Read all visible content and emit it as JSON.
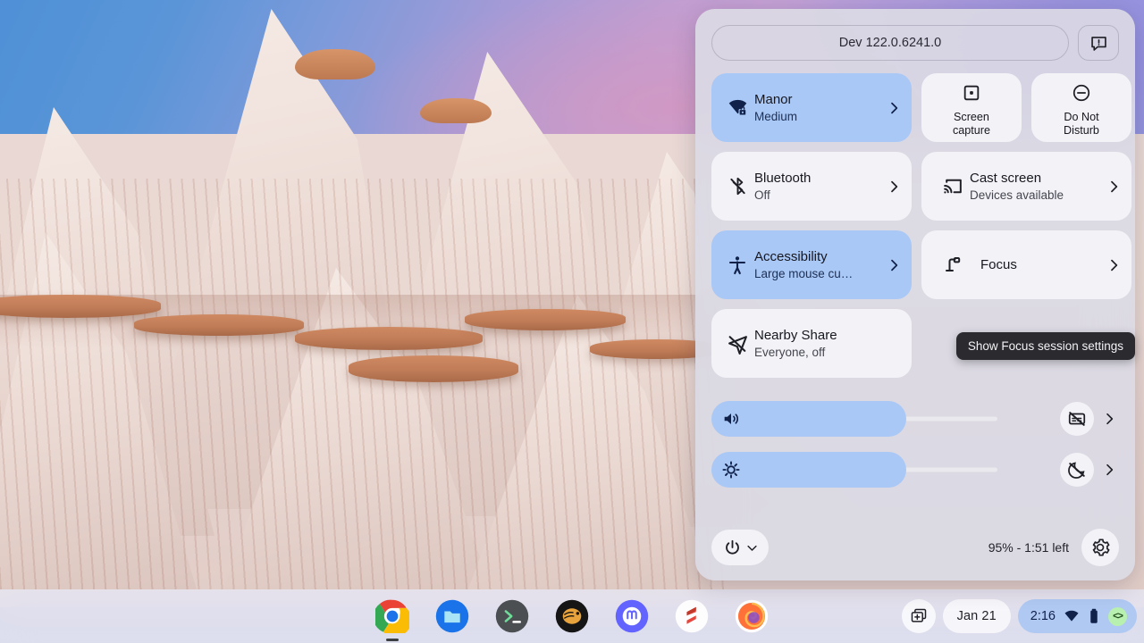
{
  "wallpaper": {
    "description": "badlands-rock-formation-wallpaper"
  },
  "quick_settings": {
    "version": {
      "label": "Dev 122.0.6241.0",
      "feedback_icon": "feedback-icon"
    },
    "tiles": [
      {
        "id": "network",
        "icon": "wifi-locked-icon",
        "title": "Manor",
        "subtitle": "Medium",
        "state": "on",
        "chevron": "›"
      },
      {
        "id": "screen-capture",
        "icon": "screen-capture-icon",
        "label_line1": "Screen",
        "label_line2": "capture",
        "state": "off"
      },
      {
        "id": "do-not-disturb",
        "icon": "do-not-disturb-icon",
        "label_line1": "Do Not",
        "label_line2": "Disturb",
        "state": "off"
      },
      {
        "id": "bluetooth",
        "icon": "bluetooth-off-icon",
        "title": "Bluetooth",
        "subtitle": "Off",
        "state": "off",
        "chevron": "›"
      },
      {
        "id": "cast-screen",
        "icon": "cast-icon",
        "title": "Cast screen",
        "subtitle": "Devices available",
        "state": "off",
        "chevron": "›"
      },
      {
        "id": "accessibility",
        "icon": "accessibility-icon",
        "title": "Accessibility",
        "subtitle": "Large mouse cu…",
        "state": "on",
        "chevron": "›"
      },
      {
        "id": "focus",
        "icon": "desk-lamp-icon",
        "title": "Focus",
        "subtitle": "",
        "state": "off",
        "chevron": "›"
      },
      {
        "id": "nearby-share",
        "icon": "nearby-share-off-icon",
        "title": "Nearby Share",
        "subtitle": "Everyone, off",
        "state": "off"
      }
    ],
    "tooltip": {
      "text": "Show Focus session settings"
    },
    "sliders": [
      {
        "id": "volume",
        "icon": "volume-up-icon",
        "value": 68,
        "action_icon": "captions-off-icon",
        "chevron": "›"
      },
      {
        "id": "brightness",
        "icon": "brightness-icon",
        "value": 68,
        "action_icon": "night-light-off-icon",
        "chevron": "›"
      }
    ],
    "bottom": {
      "power_icon": "power-icon",
      "power_chevron": "⌄",
      "battery": "95% - 1:51 left",
      "settings_icon": "gear-icon"
    }
  },
  "shelf": {
    "apps": [
      {
        "name": "chrome",
        "active": true
      },
      {
        "name": "files",
        "active": false
      },
      {
        "name": "terminal",
        "active": false
      },
      {
        "name": "bitwarden",
        "active": false
      },
      {
        "name": "mastodon",
        "active": false
      },
      {
        "name": "sublime",
        "active": false
      },
      {
        "name": "firefox",
        "active": false
      }
    ],
    "status": {
      "desk_icon": "desk-add-icon",
      "date": "Jan 21",
      "time": "2:16",
      "wifi_icon": "wifi-icon",
      "battery_icon": "battery-icon",
      "dev_badge": "<>"
    }
  },
  "colors": {
    "tile_on": "#a9c8f6",
    "tile_off": "#f2f2f7",
    "panel_bg": "#dad9e4",
    "tray_bg": "#afc9f3",
    "tooltip_bg": "#2b2b2f",
    "dev_badge_bg": "#b8f0b0"
  }
}
